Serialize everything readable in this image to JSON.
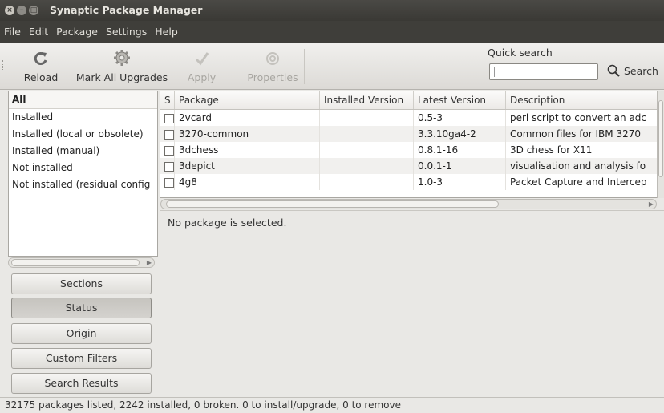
{
  "window": {
    "title": "Synaptic Package Manager",
    "buttons": [
      "×",
      "–",
      "□"
    ]
  },
  "menubar": [
    "File",
    "Edit",
    "Package",
    "Settings",
    "Help"
  ],
  "toolbar": {
    "reload": "Reload",
    "mark_all_upgrades": "Mark All Upgrades",
    "apply": "Apply",
    "properties": "Properties",
    "quick_search_label": "Quick search",
    "search": "Search"
  },
  "filters": {
    "header": "All",
    "items": [
      "Installed",
      "Installed (local or obsolete)",
      "Installed (manual)",
      "Not installed",
      "Not installed (residual config"
    ]
  },
  "filter_buttons": {
    "sections": "Sections",
    "status": "Status",
    "origin": "Origin",
    "custom_filters": "Custom Filters",
    "search_results": "Search Results"
  },
  "package_table": {
    "columns": [
      "S",
      "Package",
      "Installed Version",
      "Latest Version",
      "Description"
    ],
    "rows": [
      {
        "package": "2vcard",
        "installed": "",
        "latest": "0.5-3",
        "description": "perl script to convert an adc"
      },
      {
        "package": "3270-common",
        "installed": "",
        "latest": "3.3.10ga4-2",
        "description": "Common files for IBM 3270"
      },
      {
        "package": "3dchess",
        "installed": "",
        "latest": "0.8.1-16",
        "description": "3D chess for X11"
      },
      {
        "package": "3depict",
        "installed": "",
        "latest": "0.0.1-1",
        "description": "visualisation and analysis fo"
      },
      {
        "package": "4g8",
        "installed": "",
        "latest": "1.0-3",
        "description": "Packet Capture and Intercep"
      }
    ]
  },
  "details": {
    "text": "No package is selected."
  },
  "statusbar": {
    "text": "32175 packages listed, 2242 installed, 0 broken. 0 to install/upgrade, 0 to remove"
  },
  "icons": {
    "reload": "reload-icon",
    "mark_all_upgrades": "gear-upgrade-icon",
    "apply": "checkmark-icon",
    "properties": "properties-icon",
    "search": "magnifier-icon"
  }
}
